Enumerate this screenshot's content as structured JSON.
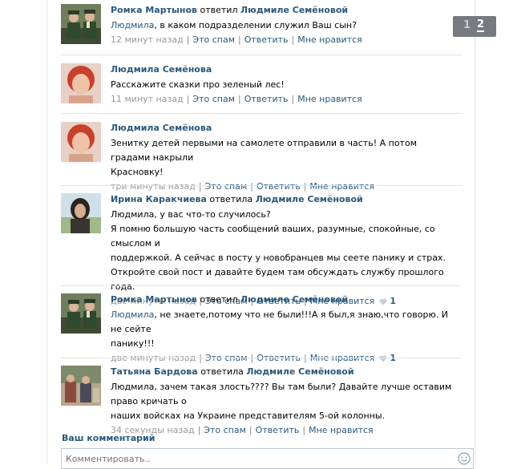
{
  "pager": {
    "pages": [
      "1",
      "2"
    ],
    "current": "2"
  },
  "comments": [
    {
      "author": "Ромка Мартынов",
      "verb": "ответил",
      "target": "Людмиле Семёновой",
      "mention": "Людмила",
      "text": ", в каком подразделении служил Ваш сын?",
      "time": "12 минут назад",
      "spam": "Это спам",
      "reply": "Ответить",
      "like": "Мне нравится",
      "likes": ""
    },
    {
      "author": "Людмила Семёнова",
      "text": "Расскажите сказки про зеленый лес!",
      "time": "11 минут назад",
      "spam": "Это спам",
      "reply": "Ответить",
      "like": "Мне нравится",
      "likes": ""
    },
    {
      "author": "Людмила Семёнова",
      "text_lines": [
        "Зенитку детей первыми на самолете отправили в часть! А потом градами накрыли",
        "Красновку!"
      ],
      "time": "три минуты назад",
      "spam": "Это спам",
      "reply": "Ответить",
      "like": "Мне нравится",
      "likes": ""
    },
    {
      "author": "Ирина Каракчиева",
      "verb": "ответила",
      "target": "Людмиле Семёновой",
      "text_lines": [
        "Людмила, у вас что-то случилось?",
        "Я помню большую часть сообщений ваших, разумные, спокойные, со смыслом и",
        "поддержкой. А сейчас в посту у новобранцев мы сеете панику и страх.",
        "Откройте свой пост и давайте будем там обсуждать службу прошлого года."
      ],
      "time": "две минуты назад",
      "spam": "Это спам",
      "reply": "Ответить",
      "like": "Мне нравится",
      "likes": "1"
    },
    {
      "author": "Ромка Мартынов",
      "verb": "ответил",
      "target": "Людмиле Семёновой",
      "mention": "Людмила",
      "text_lines": [
        ", не знаете,потому что не были!!!А я был,я знаю,что говорю. И не сейте",
        "панику!!!"
      ],
      "time": "две минуты назад",
      "spam": "Это спам",
      "reply": "Ответить",
      "like": "Мне нравится",
      "likes": "1"
    },
    {
      "author": "Татьяна Бардова",
      "verb": "ответила",
      "target": "Людмиле Семёновой",
      "text_lines": [
        "Людмила, зачем такая злость???? Вы там были? Давайте лучше оставим право кричать о",
        "наших войсках на Украине представителям 5-ой колонны."
      ],
      "time": "34 секунды назад",
      "spam": "Это спам",
      "reply": "Ответить",
      "like": "Мне нравится",
      "likes": ""
    }
  ],
  "your_comment": {
    "title": "Ваш комментарий",
    "placeholder": "Комментировать.."
  },
  "icons": {
    "like": "heart-icon",
    "emoji": "smile-icon"
  },
  "colors": {
    "link": "#2b587a",
    "meta": "#999999",
    "pager_bg": "#777a7e"
  }
}
